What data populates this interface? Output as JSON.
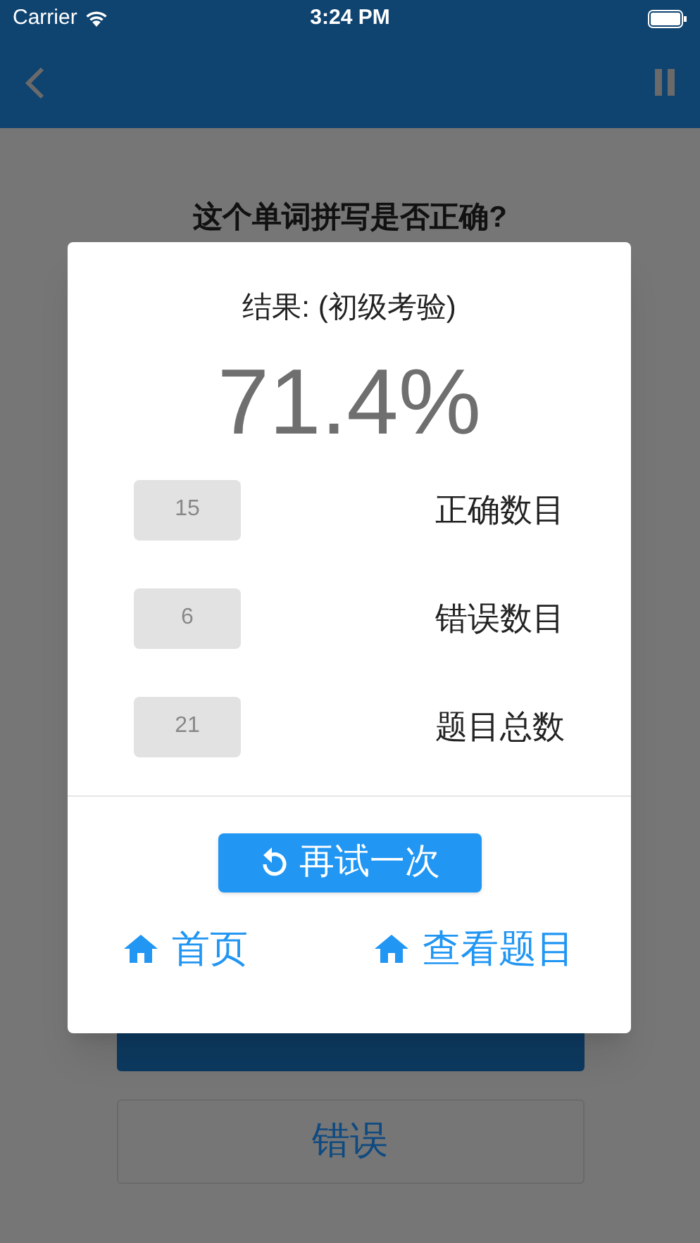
{
  "status_bar": {
    "carrier": "Carrier",
    "time": "3:24 PM"
  },
  "question": "这个单词拼写是否正确?",
  "answer_buttons": [
    {
      "kind": "filled"
    },
    {
      "label": "错误",
      "kind": "outline"
    }
  ],
  "result_dialog": {
    "title": "结果: (初级考验)",
    "percent": "71.4%",
    "stats": [
      {
        "value": "15",
        "label": "正确数目"
      },
      {
        "value": "6",
        "label": "错误数目"
      },
      {
        "value": "21",
        "label": "题目总数"
      }
    ],
    "retry_button": "再试一次",
    "links": [
      {
        "label": "首页"
      },
      {
        "label": "查看题目"
      }
    ]
  }
}
